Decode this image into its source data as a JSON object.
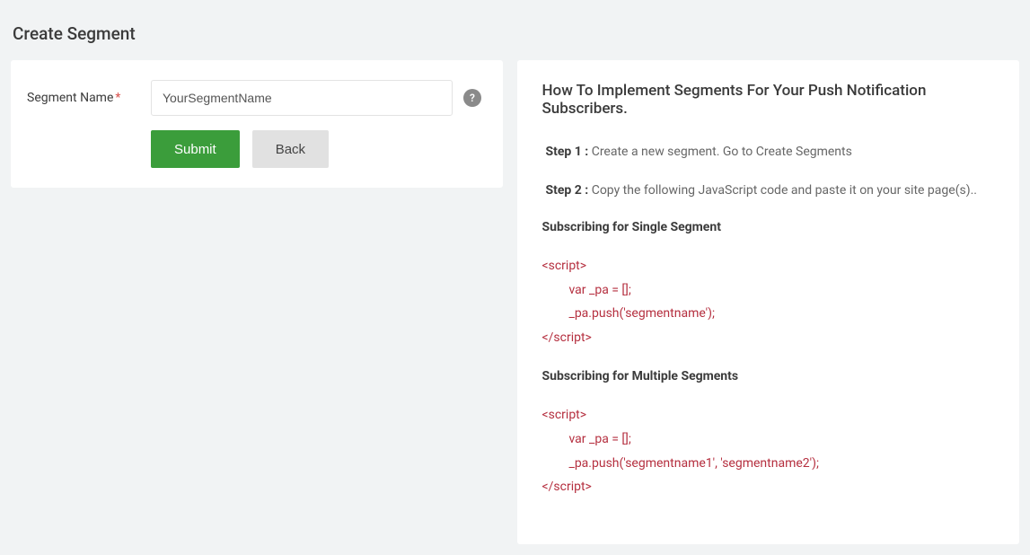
{
  "page_title": "Create Segment",
  "form": {
    "label_segment_name": "Segment Name",
    "required_mark": "*",
    "segment_name_value": "YourSegmentName",
    "help_char": "?",
    "submit_label": "Submit",
    "back_label": "Back"
  },
  "right": {
    "title": "How To Implement Segments For Your Push Notification Subscribers.",
    "step1_label": "Step 1 :",
    "step1_text": " Create a new segment. Go to Create Segments",
    "step2_label": "Step 2 :",
    "step2_text": " Copy the following JavaScript code and paste it on your site page(s)..",
    "single_header": "Subscribing for Single Segment",
    "code_single_open": "<script>",
    "code_single_line1": "var _pa = [];",
    "code_single_line2": "_pa.push('segmentname');",
    "code_single_close": "</script>",
    "multi_header": "Subscribing for Multiple Segments",
    "code_multi_open": "<script>",
    "code_multi_line1": "var _pa = [];",
    "code_multi_line2": "_pa.push('segmentname1', 'segmentname2');",
    "code_multi_close": "</script>"
  }
}
